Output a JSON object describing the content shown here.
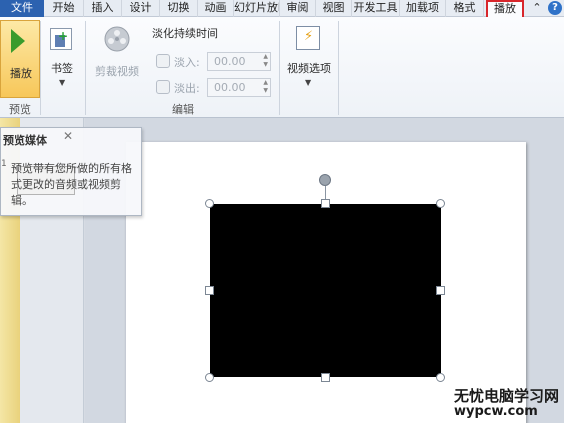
{
  "tabs": {
    "file": "文件",
    "items": [
      "开始",
      "插入",
      "设计",
      "切换",
      "动画",
      "幻灯片放映",
      "审阅",
      "视图",
      "开发工具",
      "加载项",
      "格式"
    ],
    "active": "播放",
    "extra_icon": "chevron-up-icon",
    "help": "?"
  },
  "ribbon": {
    "preview": {
      "play_label": "播放",
      "group_label": "预览"
    },
    "bookmarks": {
      "label": "书签"
    },
    "editing": {
      "trim_label": "剪裁视频",
      "fade_title": "淡化持续时间",
      "fade_in_label": "淡入:",
      "fade_in_value": "00.00",
      "fade_out_label": "淡出:",
      "fade_out_value": "00.00",
      "group_label": "编辑"
    },
    "video_options": {
      "label": "视频选项"
    }
  },
  "tooltip": {
    "title": "预览媒体",
    "body": "预览带有您所做的所有格式更改的音频或视频剪辑。",
    "slide_number": "1"
  },
  "watermark": {
    "line1": "无忧电脑学习网",
    "line2": "wypcw.com"
  },
  "colors": {
    "file_tab": "#2c62b0",
    "active_tab_outline": "#d8262b",
    "play_button": "#f7c75a"
  }
}
